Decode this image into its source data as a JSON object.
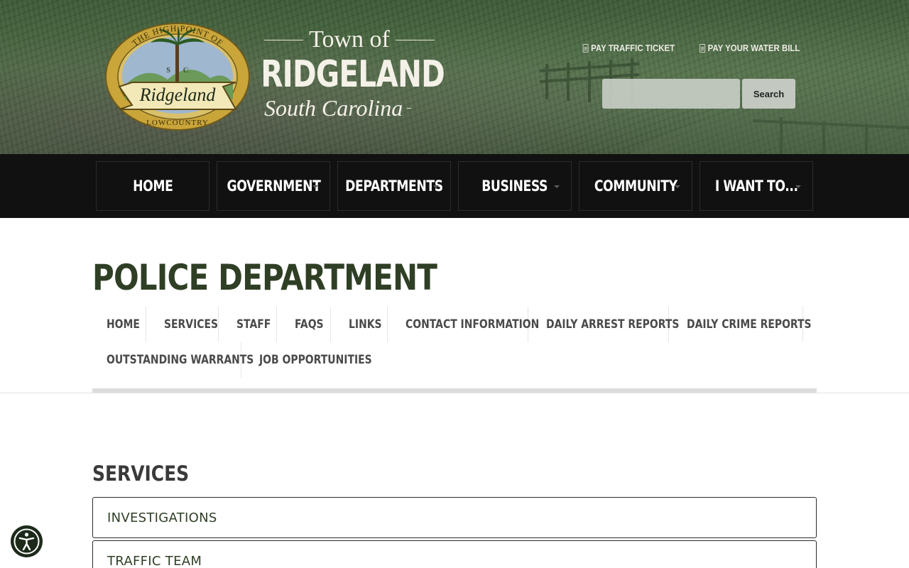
{
  "header": {
    "brand": {
      "town_of": "Town of",
      "city": "RIDGELAND",
      "state": "South Carolina"
    },
    "seal": {
      "top_text": "THE HIGH POINT OF",
      "bottom_text": "LOWCOUNTRY",
      "banner": "Ridgeland",
      "state_abbr": "S C"
    },
    "quick_links": [
      {
        "label": "PAY TRAFFIC TICKET",
        "icon": "document-icon"
      },
      {
        "label": "PAY YOUR WATER BILL",
        "icon": "document-icon"
      }
    ],
    "search": {
      "placeholder": "",
      "button": "Search"
    }
  },
  "main_nav": [
    {
      "label": "HOME",
      "dropdown": false
    },
    {
      "label": "GOVERNMENT",
      "dropdown": true
    },
    {
      "label": "DEPARTMENTS",
      "dropdown": true
    },
    {
      "label": "BUSINESS",
      "dropdown": true
    },
    {
      "label": "COMMUNITY",
      "dropdown": true
    },
    {
      "label": "I WANT TO...",
      "dropdown": true
    }
  ],
  "page": {
    "title": "POLICE DEPARTMENT",
    "sub_nav": [
      "HOME",
      "SERVICES",
      "STAFF",
      "FAQS",
      "LINKS",
      "CONTACT INFORMATION",
      "DAILY ARREST REPORTS",
      "DAILY CRIME REPORTS",
      "OUTSTANDING WARRANTS",
      "JOB OPPORTUNITIES"
    ],
    "section_title": "SERVICES",
    "accordion": [
      "INVESTIGATIONS",
      "TRAFFIC TEAM"
    ]
  },
  "accessibility": {
    "icon": "accessibility-icon"
  },
  "colors": {
    "header_green": "#3d5a37",
    "nav_black": "#111111",
    "title_green": "#2f3f25",
    "seal_gold": "#c9a53a"
  }
}
